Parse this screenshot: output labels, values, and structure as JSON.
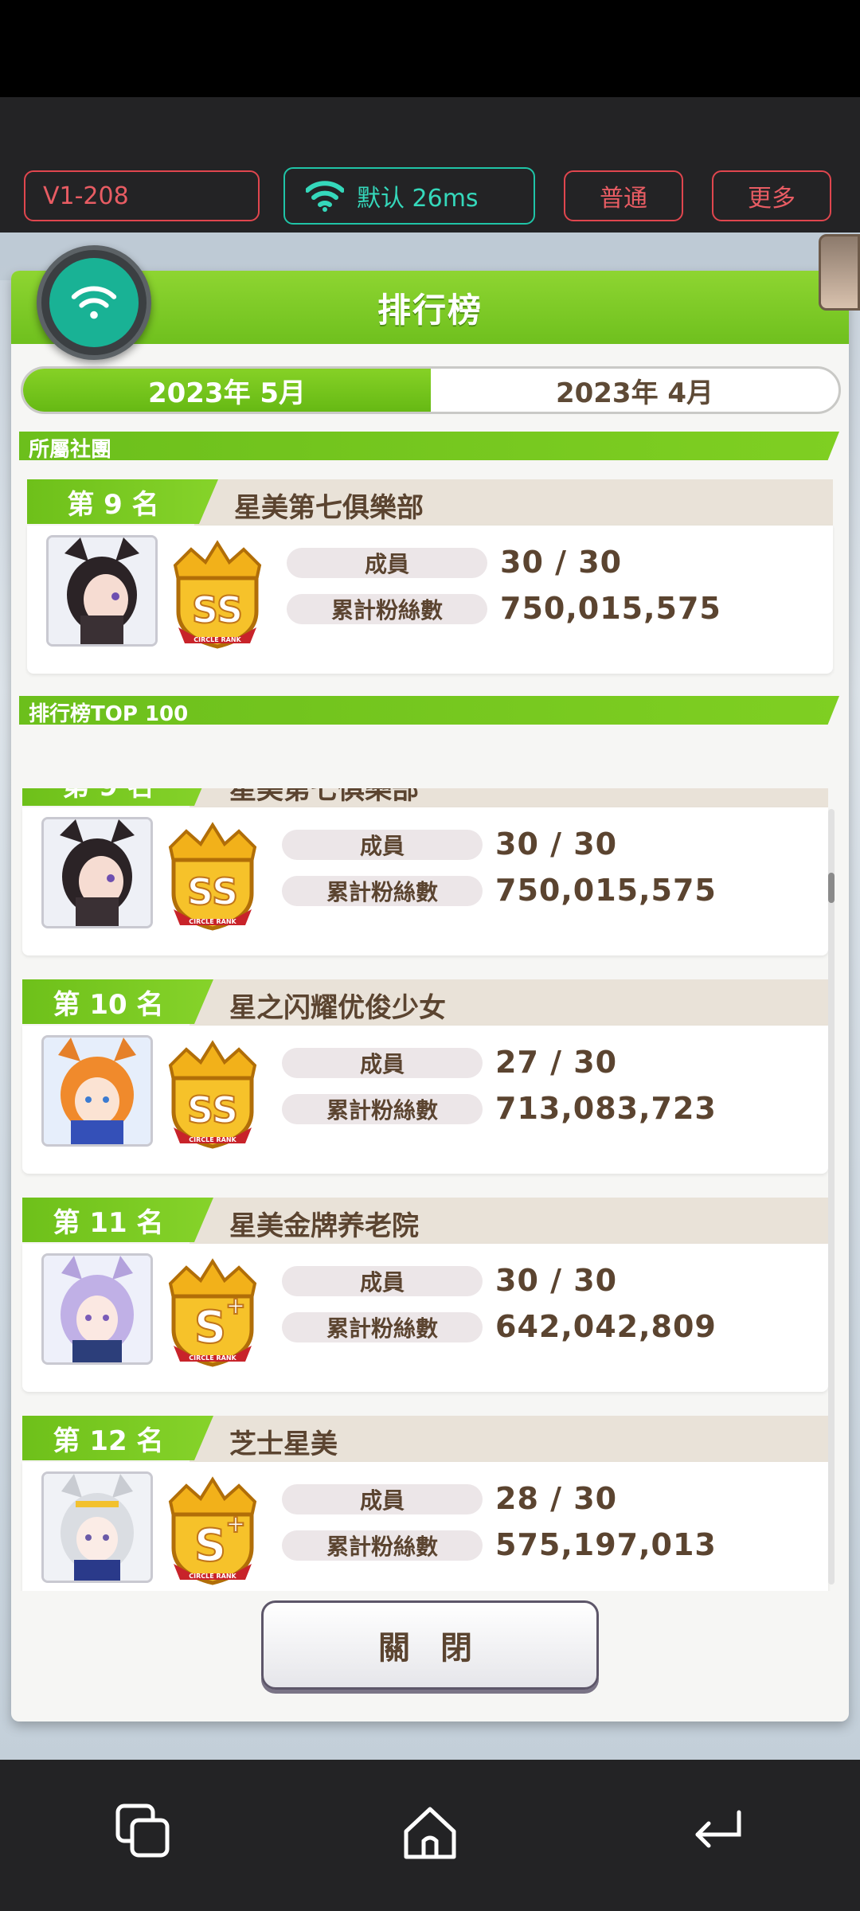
{
  "toolbar": {
    "version": "V1-208",
    "network": "默认 26ms",
    "mode": "普通",
    "more": "更多"
  },
  "panel": {
    "title": "排行榜",
    "tabs": [
      {
        "label": "2023年 5月",
        "active": true
      },
      {
        "label": "2023年 4月",
        "active": false
      }
    ],
    "my_section": "所屬社團",
    "top_section": "排行榜TOP 100",
    "stat_labels": {
      "members": "成員",
      "fans": "累計粉絲數"
    },
    "my_club": {
      "rank": "第 9 名",
      "name": "星美第七俱樂部",
      "members": "30 / 30",
      "fans": "750,015,575",
      "grade": "SS"
    },
    "entries": [
      {
        "rank": "第 9 名",
        "name": "星美第七俱樂部",
        "members": "30 / 30",
        "fans": "750,015,575",
        "grade": "SS"
      },
      {
        "rank": "第 10 名",
        "name": "星之闪耀优俊少女",
        "members": "27 / 30",
        "fans": "713,083,723",
        "grade": "SS"
      },
      {
        "rank": "第 11 名",
        "name": "星美金牌养老院",
        "members": "30 / 30",
        "fans": "642,042,809",
        "grade": "S+"
      },
      {
        "rank": "第 12 名",
        "name": "芝士星美",
        "members": "28 / 30",
        "fans": "575,197,013",
        "grade": "S+"
      }
    ],
    "badge_caption": "CIRCLE RANK",
    "close": "關 閉"
  },
  "colors": {
    "accent_green": "#6ec01a",
    "brown_text": "#5b4430",
    "toolbar_red": "#e0464e",
    "toolbar_teal": "#1fc4a7"
  }
}
